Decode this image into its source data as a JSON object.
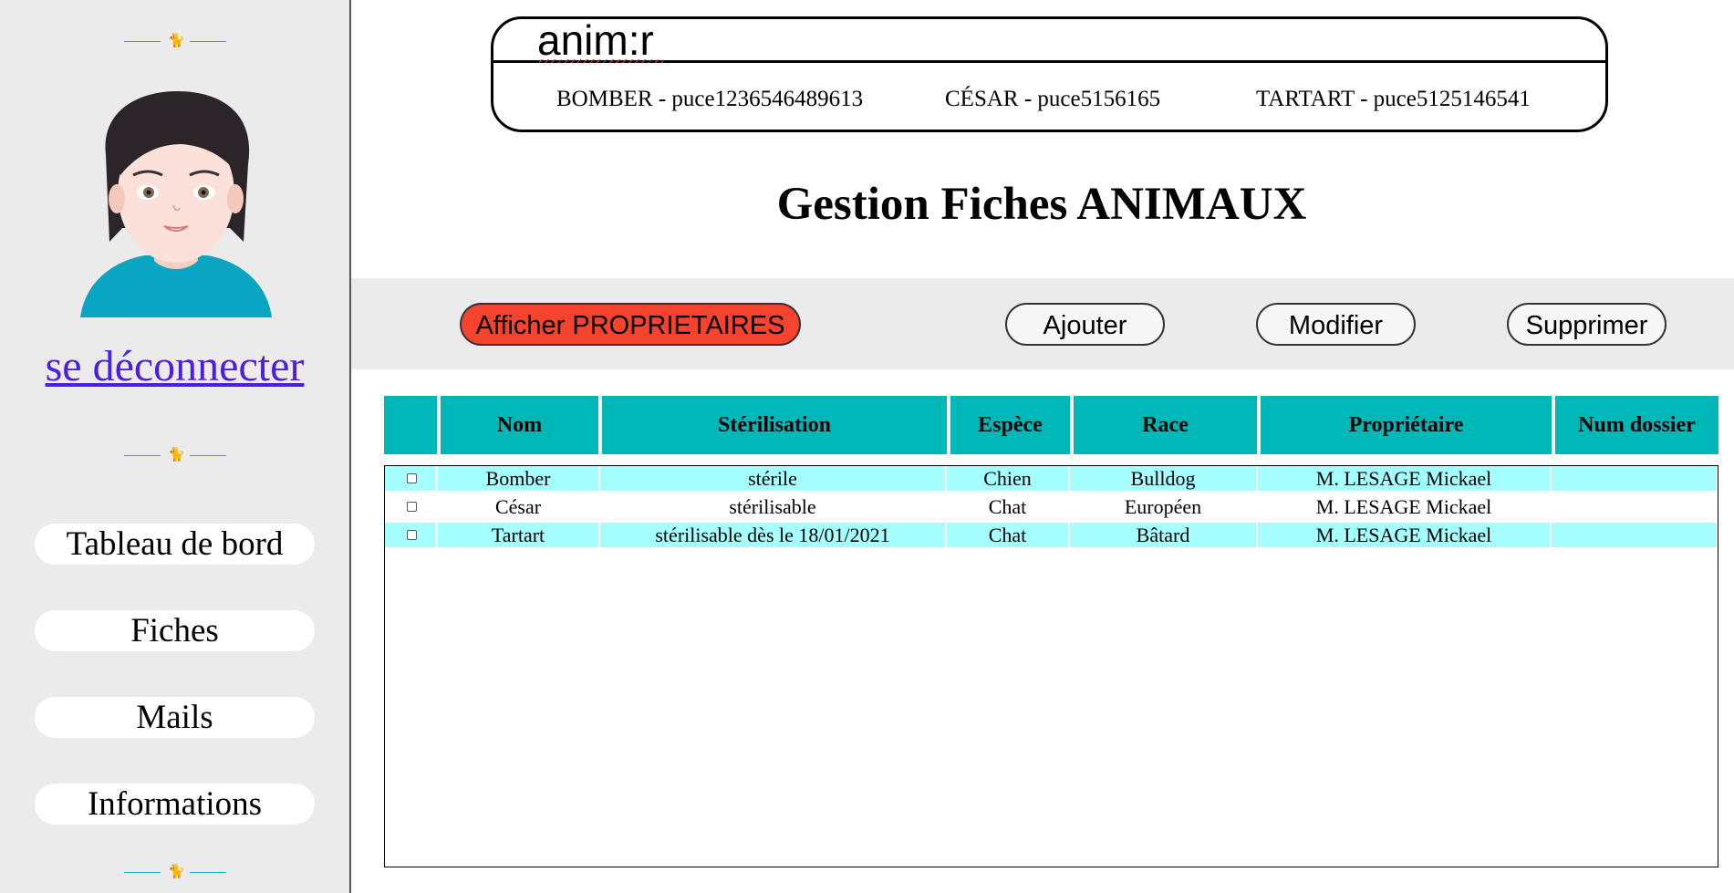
{
  "app": {
    "search_value": "anim:r"
  },
  "header": {
    "animals": [
      "BOMBER - puce1236546489613",
      "CÉSAR - puce5156165",
      "TARTART - puce5125146541"
    ]
  },
  "sidebar": {
    "logout_label": "se déconnecter",
    "nav": [
      "Tableau de bord",
      "Fiches",
      "Mails",
      "Informations"
    ],
    "divider_icon": "cat-icon"
  },
  "page": {
    "title": "Gestion Fiches ANIMAUX"
  },
  "actions": {
    "owners_label": "Afficher PROPRIETAIRES",
    "add_label": "Ajouter",
    "edit_label": "Modifier",
    "delete_label": "Supprimer"
  },
  "table": {
    "headers": [
      "",
      "Nom",
      "Stérilisation",
      "Espèce",
      "Race",
      "Propriétaire",
      "Num dossier"
    ],
    "rows": [
      [
        "Bomber",
        "stérile",
        "Chien",
        "Bulldog",
        "M. LESAGE Mickael",
        ""
      ],
      [
        "César",
        "stérilisable",
        "Chat",
        "Européen",
        "M. LESAGE Mickael",
        ""
      ],
      [
        "Tartart",
        "stérilisable dès le 18/01/2021",
        "Chat",
        "Bâtard",
        "M. LESAGE Mickael",
        ""
      ]
    ]
  },
  "colors": {
    "accent": "#00b7b7",
    "row_highlight": "#a5ffff",
    "owners_button": "#f6432d",
    "link": "#4b1ee0"
  }
}
